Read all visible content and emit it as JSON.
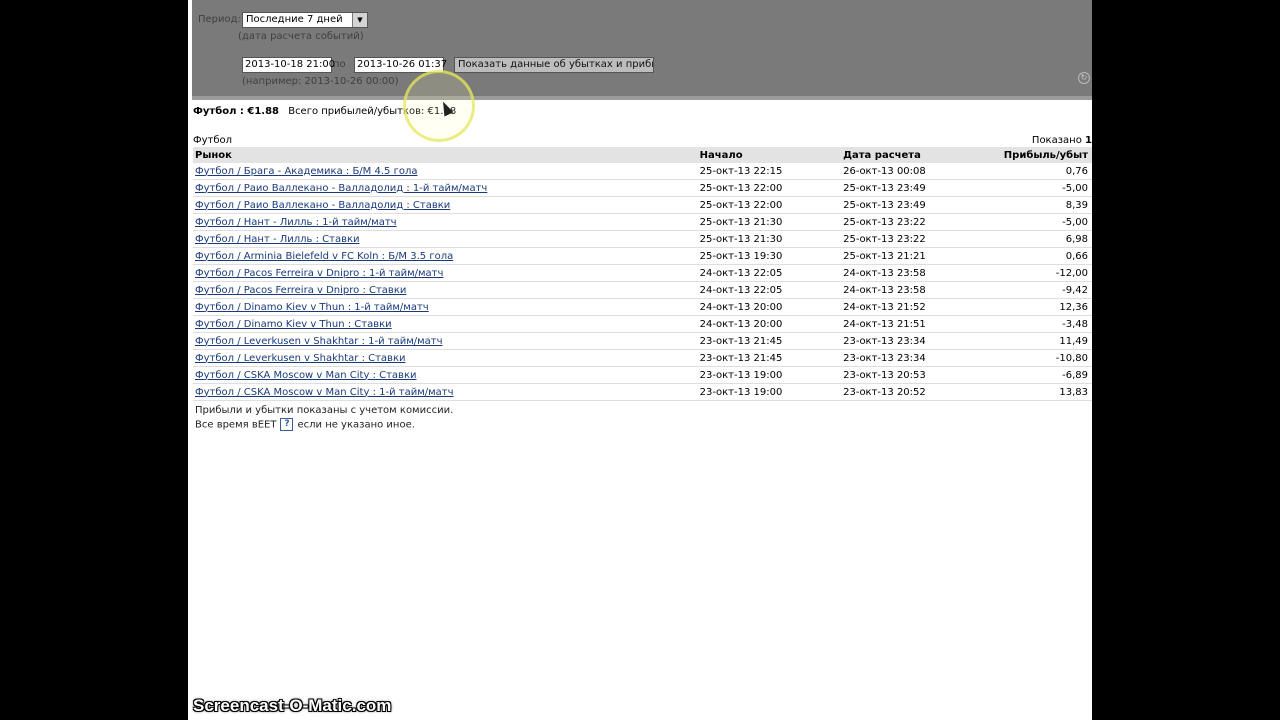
{
  "filter": {
    "period_label": "Период:",
    "period_value": "Последние 7 дней",
    "date_label": "(дата расчета событий)",
    "from_value": "2013-10-18 21:00",
    "to_label": "по",
    "to_value": "2013-10-26 01:37",
    "show_button": "Показать данные об убытках и прибыли",
    "range_hint": "(например: 2013-10-26 00:00)"
  },
  "summary": {
    "sport_total": "Футбол : €1.88",
    "overall_label": "Всего прибылей/убытков:",
    "overall_value": "€1.88"
  },
  "section_title": "Футбол",
  "shown_label": "Показано",
  "shown_value": "1",
  "columns": {
    "market": "Рынок",
    "start": "Начало",
    "settled": "Дата расчета",
    "pl": "Прибыль/убыт"
  },
  "rows": [
    {
      "market": "Футбол / Брага - Академика : Б/М 4.5 гола",
      "start": "25-окт-13 22:15",
      "settled": "26-окт-13 00:08",
      "pl": "0,76"
    },
    {
      "market": "Футбол / Раио Валлекано - Валладолид : 1-й тайм/матч",
      "start": "25-окт-13 22:00",
      "settled": "25-окт-13 23:49",
      "pl": "-5,00"
    },
    {
      "market": "Футбол / Раио Валлекано - Валладолид : Ставки",
      "start": "25-окт-13 22:00",
      "settled": "25-окт-13 23:49",
      "pl": "8,39"
    },
    {
      "market": "Футбол / Нант - Лилль : 1-й тайм/матч",
      "start": "25-окт-13 21:30",
      "settled": "25-окт-13 23:22",
      "pl": "-5,00"
    },
    {
      "market": "Футбол / Нант - Лилль : Ставки",
      "start": "25-окт-13 21:30",
      "settled": "25-окт-13 23:22",
      "pl": "6,98"
    },
    {
      "market": "Футбол / Arminia Bielefeld v FC Koln : Б/М 3.5 гола",
      "start": "25-окт-13 19:30",
      "settled": "25-окт-13 21:21",
      "pl": "0,66"
    },
    {
      "market": "Футбол / Pacos Ferreira v Dnipro : 1-й тайм/матч",
      "start": "24-окт-13 22:05",
      "settled": "24-окт-13 23:58",
      "pl": "-12,00"
    },
    {
      "market": "Футбол / Pacos Ferreira v Dnipro : Ставки",
      "start": "24-окт-13 22:05",
      "settled": "24-окт-13 23:58",
      "pl": "-9,42"
    },
    {
      "market": "Футбол / Dinamo Kiev v Thun : 1-й тайм/матч",
      "start": "24-окт-13 20:00",
      "settled": "24-окт-13 21:52",
      "pl": "12,36"
    },
    {
      "market": "Футбол / Dinamo Kiev v Thun : Ставки",
      "start": "24-окт-13 20:00",
      "settled": "24-окт-13 21:51",
      "pl": "-3,48"
    },
    {
      "market": "Футбол / Leverkusen v Shakhtar : 1-й тайм/матч",
      "start": "23-окт-13 21:45",
      "settled": "23-окт-13 23:34",
      "pl": "11,49"
    },
    {
      "market": "Футбол / Leverkusen v Shakhtar : Ставки",
      "start": "23-окт-13 21:45",
      "settled": "23-окт-13 23:34",
      "pl": "-10,80"
    },
    {
      "market": "Футбол / CSKA Moscow v Man City : Ставки",
      "start": "23-окт-13 19:00",
      "settled": "23-окт-13 20:53",
      "pl": "-6,89"
    },
    {
      "market": "Футбол / CSKA Moscow v Man City : 1-й тайм/матч",
      "start": "23-окт-13 19:00",
      "settled": "23-окт-13 20:52",
      "pl": "13,83"
    }
  ],
  "footnote_1": "Прибыли и убытки показаны с учетом комиссии.",
  "footnote_2_before": "Все время вЕЕТ",
  "help_icon": "?",
  "footnote_2_after": "если не указано иное.",
  "watermark": "Screencast-O-Matic.com",
  "icons": {
    "select_arrow": "arrow-down-icon",
    "help": "help-icon",
    "corner": "refresh-icon"
  }
}
